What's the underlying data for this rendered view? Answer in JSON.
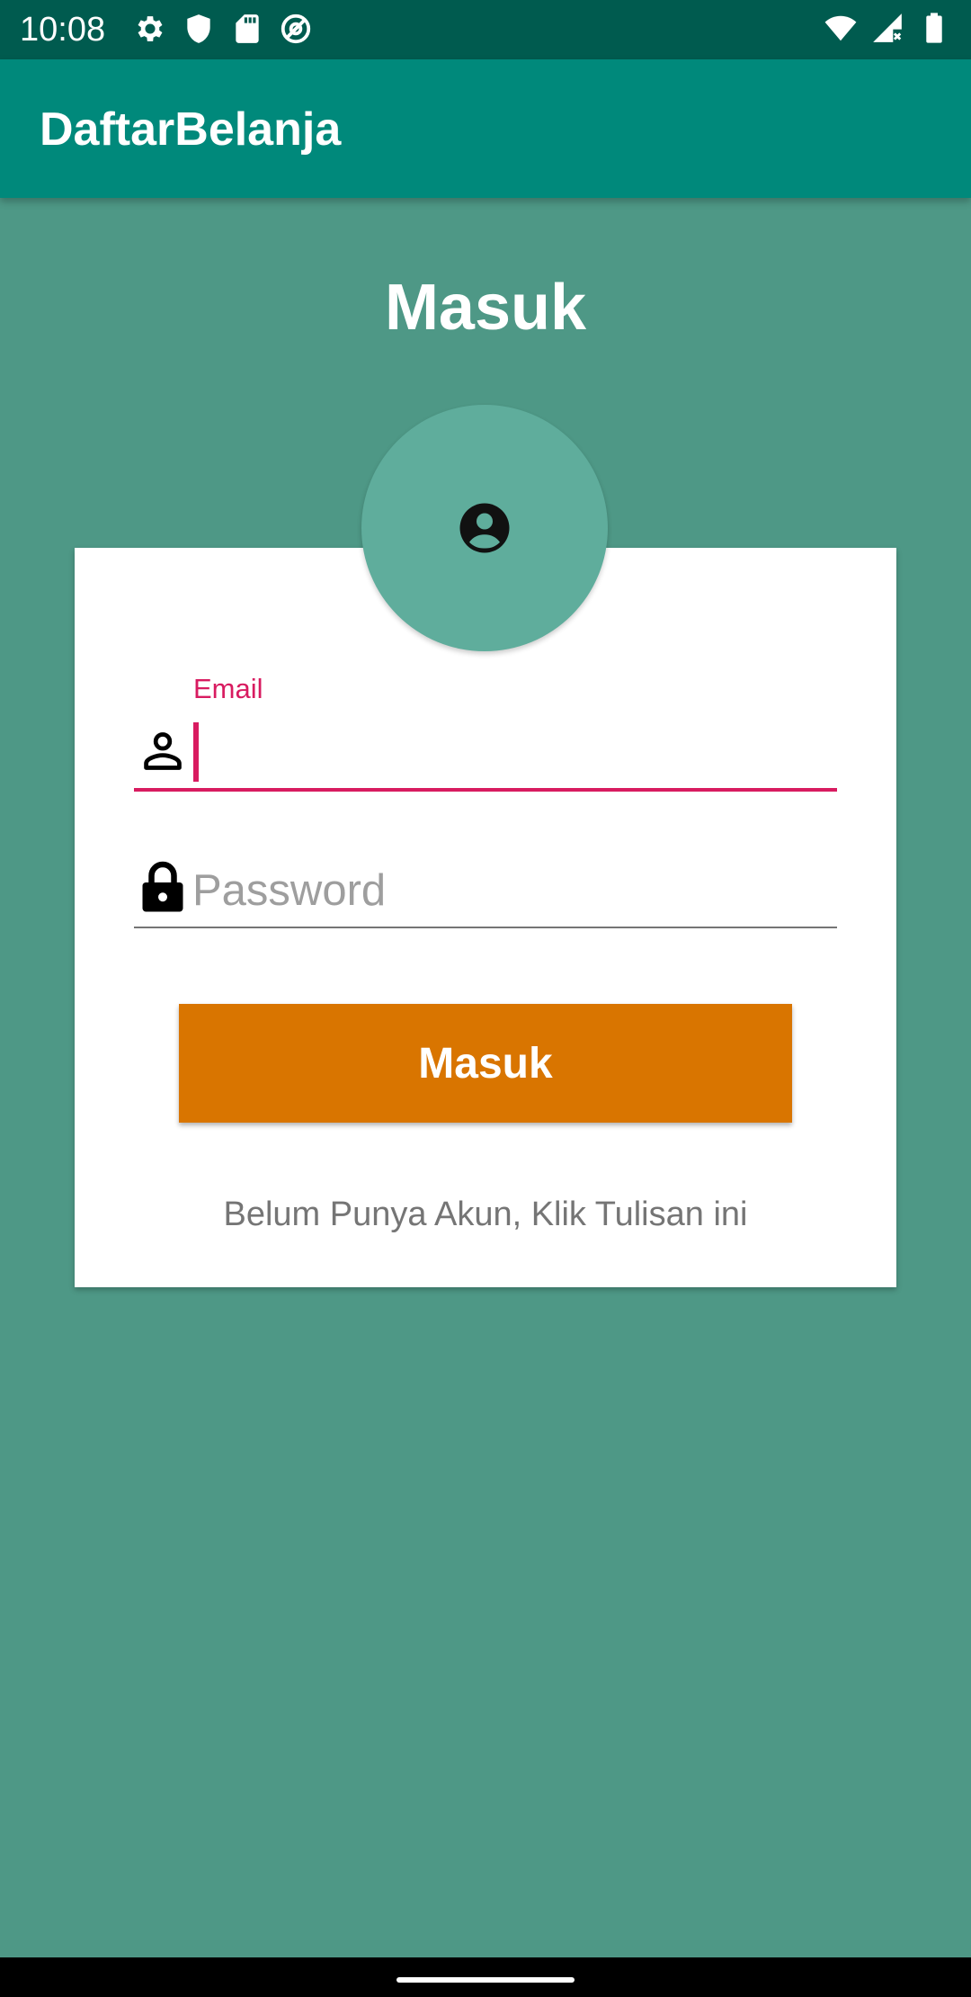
{
  "status_bar": {
    "time": "10:08",
    "left_icons": [
      "settings-icon",
      "shield-icon",
      "sd-card-icon",
      "at-sign-icon"
    ],
    "right_icons": [
      "wifi-icon",
      "signal-icon",
      "battery-icon"
    ]
  },
  "app_bar": {
    "title": "DaftarBelanja",
    "color": "#00897B"
  },
  "page": {
    "heading": "Masuk",
    "background_color": "#4E9886"
  },
  "form": {
    "avatar_icon": "account-circle-icon",
    "email": {
      "label": "Email",
      "value": "",
      "placeholder": "",
      "icon": "person-icon",
      "accent_color": "#D81B60"
    },
    "password": {
      "value": "",
      "placeholder": "Password",
      "icon": "lock-icon"
    },
    "submit_label": "Masuk",
    "submit_color": "#D97500",
    "register_text": "Belum Punya Akun, Klik Tulisan ini"
  }
}
